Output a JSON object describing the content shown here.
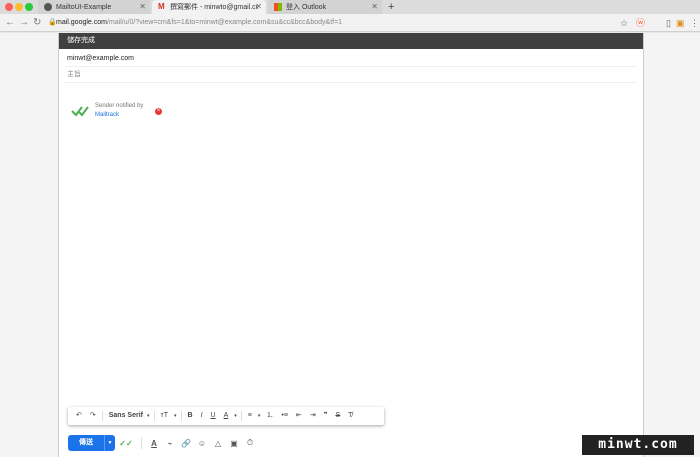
{
  "browser": {
    "tabs": [
      {
        "title": "MailtoUI-Example",
        "active": false
      },
      {
        "title": "撰寫郵件 - minwto@gmail.com",
        "active": true
      },
      {
        "title": "登入 Outlook",
        "active": false
      }
    ],
    "new_tab_label": "+",
    "url_host": "mail.google.com",
    "url_rest": "/mail/u/0/?view=cm&fs=1&to=minwt@example.com&su&cc&bcc&body&tf=1",
    "traffic_colors": [
      "#ff5f57",
      "#febc2e",
      "#28c840"
    ]
  },
  "compose": {
    "header": "儲存完成",
    "to": "minwt@example.com",
    "subject_placeholder": "主旨",
    "mailtrack": {
      "line1": "Sender notified by",
      "line2": "Mailtrack",
      "check_color": "#4caf50",
      "close_color": "#e53935"
    },
    "format": {
      "undo": "↶",
      "redo": "↷",
      "font": "Sans Serif",
      "caret": "▾",
      "size": "ᴛT",
      "bold": "B",
      "italic": "I",
      "underline": "U",
      "color": "A",
      "align": "≡",
      "numbered": "⒈",
      "bulleted": "•≡",
      "indent_less": "⇤",
      "indent_more": "⇥",
      "quote": "❞",
      "strike": "S",
      "clear": "T̸"
    },
    "send_label": "傳送",
    "send_dropdown": "▼",
    "send_color": "#1a73e8",
    "bottom_icons": {
      "mailtrack": "✓✓",
      "text_color": "A",
      "attach": "⌁",
      "link": "🔗",
      "emoji": "☺",
      "drive": "△",
      "photo": "▣",
      "confidential": "⏱"
    }
  },
  "watermark": "minwt.com"
}
